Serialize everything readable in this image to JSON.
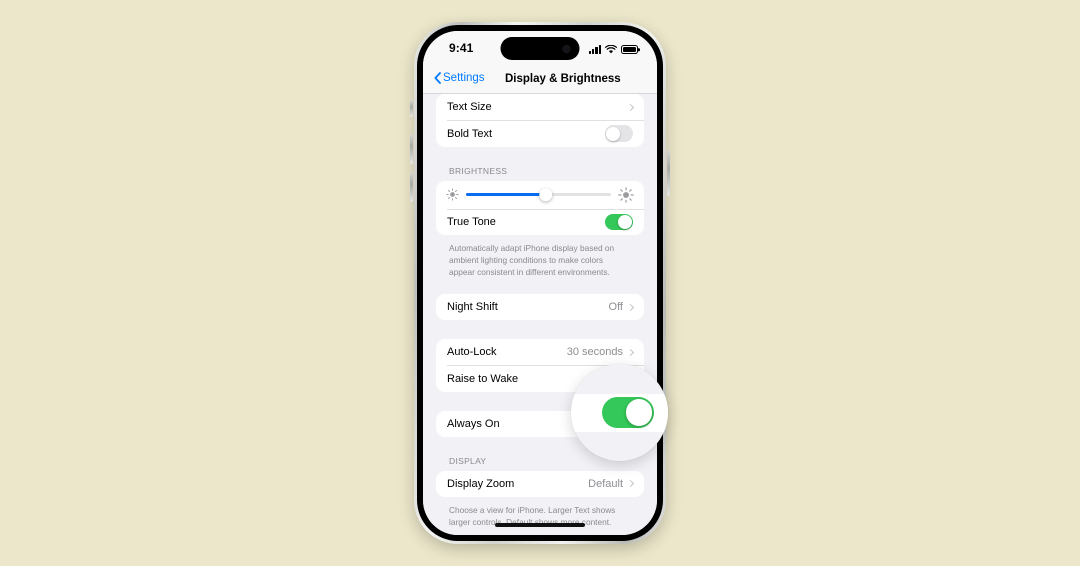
{
  "background_color": "#ece7ca",
  "accent_color": "#007aff",
  "toggle_on_color": "#34c759",
  "slider_fill_color": "#0a6cf0",
  "status_bar": {
    "time": "9:41",
    "signal_icon": "cellular-signal-icon",
    "wifi_icon": "wifi-icon",
    "battery_icon": "battery-icon"
  },
  "nav": {
    "back_label": "Settings",
    "title": "Display & Brightness"
  },
  "groups": [
    {
      "rows": [
        {
          "label": "Text Size",
          "value": "",
          "control": "chevron"
        },
        {
          "label": "Bold Text",
          "value": "",
          "control": "toggle-off"
        }
      ]
    }
  ],
  "brightness": {
    "header": "BRIGHTNESS",
    "slider": {
      "value_percent": 55,
      "min_icon": "brightness-low-icon",
      "max_icon": "brightness-high-icon"
    },
    "true_tone": {
      "label": "True Tone",
      "control": "toggle-on"
    },
    "footnote": "Automatically adapt iPhone display based on ambient lighting conditions to make colors appear consistent in different environments."
  },
  "night_shift": {
    "label": "Night Shift",
    "value": "Off",
    "control": "chevron"
  },
  "lock_group": {
    "auto_lock": {
      "label": "Auto-Lock",
      "value": "30 seconds",
      "control": "chevron"
    },
    "raise_to_wake": {
      "label": "Raise to Wake",
      "control": "toggle-on"
    }
  },
  "always_on": {
    "label": "Always On",
    "control": "toggle-on"
  },
  "display_section": {
    "header": "DISPLAY",
    "display_zoom": {
      "label": "Display Zoom",
      "value": "Default",
      "control": "chevron"
    },
    "footnote": "Choose a view for iPhone. Larger Text shows larger controls. Default shows more content."
  },
  "magnifier": {
    "target": "always-on-toggle",
    "state": "on"
  }
}
